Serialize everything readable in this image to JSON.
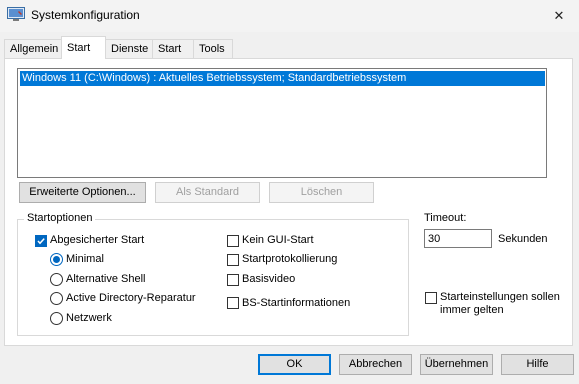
{
  "window": {
    "title": "Systemkonfiguration",
    "close_symbol": "✕"
  },
  "tabs": [
    {
      "label": "Allgemein",
      "active": false
    },
    {
      "label": "Start",
      "active": true
    },
    {
      "label": "Dienste",
      "active": false
    },
    {
      "label": "Start",
      "active": false
    },
    {
      "label": "Tools",
      "active": false
    }
  ],
  "boot_list": {
    "entries": [
      "Windows 11 (C:\\Windows) : Aktuelles Betriebssystem; Standardbetriebssystem"
    ],
    "selected_index": 0
  },
  "boot_buttons": {
    "advanced": "Erweiterte Optionen...",
    "set_default": "Als Standard",
    "delete": "Löschen"
  },
  "boot_options": {
    "group_label": "Startoptionen",
    "safe_boot": {
      "label": "Abgesicherter Start",
      "checked": true
    },
    "radios": [
      {
        "label": "Minimal",
        "checked": true
      },
      {
        "label": "Alternative Shell",
        "checked": false
      },
      {
        "label": "Active Directory-Reparatur",
        "checked": false
      },
      {
        "label": "Netzwerk",
        "checked": false
      }
    ],
    "right_checks": [
      {
        "label": "Kein GUI-Start",
        "checked": false
      },
      {
        "label": "Startprotokollierung",
        "checked": false
      },
      {
        "label": "Basisvideo",
        "checked": false
      },
      {
        "label": "BS-Startinformationen",
        "checked": false
      }
    ]
  },
  "timeout": {
    "label": "Timeout:",
    "value": "30",
    "unit": "Sekunden"
  },
  "permanent": {
    "line1": "Starteinstellungen sollen",
    "line2": "immer gelten",
    "checked": false
  },
  "dialog_buttons": {
    "ok": "OK",
    "cancel": "Abbrechen",
    "apply": "Übernehmen",
    "help": "Hilfe"
  },
  "colors": {
    "accent": "#0078d7",
    "check_fill": "#0067c0"
  }
}
